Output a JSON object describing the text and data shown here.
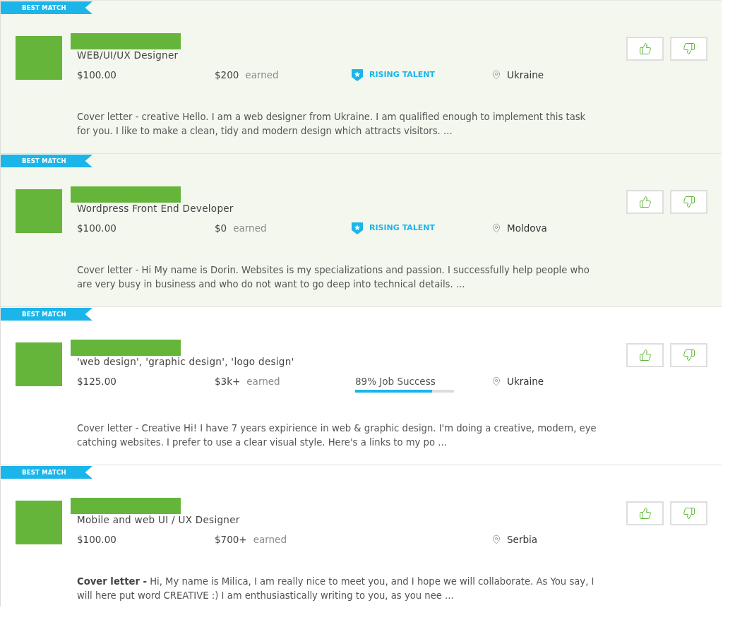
{
  "proposals": [
    {
      "badge": "BEST MATCH",
      "highlighted": true,
      "title": "WEB/UI/UX Designer",
      "rate": "$100.00",
      "earned_amount": "$200",
      "earned_label": "earned",
      "stat": {
        "kind": "rising_talent",
        "label": "RISING TALENT"
      },
      "location": "Ukraine",
      "cover_letter": "Cover letter - creative Hello. I am a web designer from Ukraine. I am qualified enough to implement this task for you. I like to make a clean, tidy and modern design which attracts visitors. ..."
    },
    {
      "badge": "BEST MATCH",
      "highlighted": true,
      "title": "Wordpress Front End Developer",
      "rate": "$100.00",
      "earned_amount": "$0",
      "earned_label": "earned",
      "stat": {
        "kind": "rising_talent",
        "label": "RISING TALENT"
      },
      "location": "Moldova",
      "cover_letter": "Cover letter - Hi My name is Dorin. Websites is my specializations and passion. I successfully help people who are very busy in business and who do not want to go deep into technical details. ..."
    },
    {
      "badge": "BEST MATCH",
      "highlighted": false,
      "title": "'web design', 'graphic design', 'logo design'",
      "rate": "$125.00",
      "earned_amount": "$3k+",
      "earned_label": "earned",
      "stat": {
        "kind": "job_success",
        "label": "89% Job Success",
        "level": 0.78
      },
      "location": "Ukraine",
      "cover_letter": "Cover letter - Creative Hi! I have 7 years expirience in web & graphic design. I'm doing a creative, modern, eye catching websites. I prefer to use a clear visual style. Here's a links to my po ..."
    },
    {
      "badge": "BEST MATCH",
      "highlighted": false,
      "title": "Mobile and web UI / UX Designer",
      "rate": "$100.00",
      "earned_amount": "$700+",
      "earned_label": "earned",
      "location": "Serbia",
      "cover_letter": "**Cover letter -** Hi, My name is Milica, I am really nice to meet you, and I hope we will collaborate. As You say, I will here put word CREATIVE :) I am enthusiastically writing to you, as you nee ..."
    }
  ]
}
